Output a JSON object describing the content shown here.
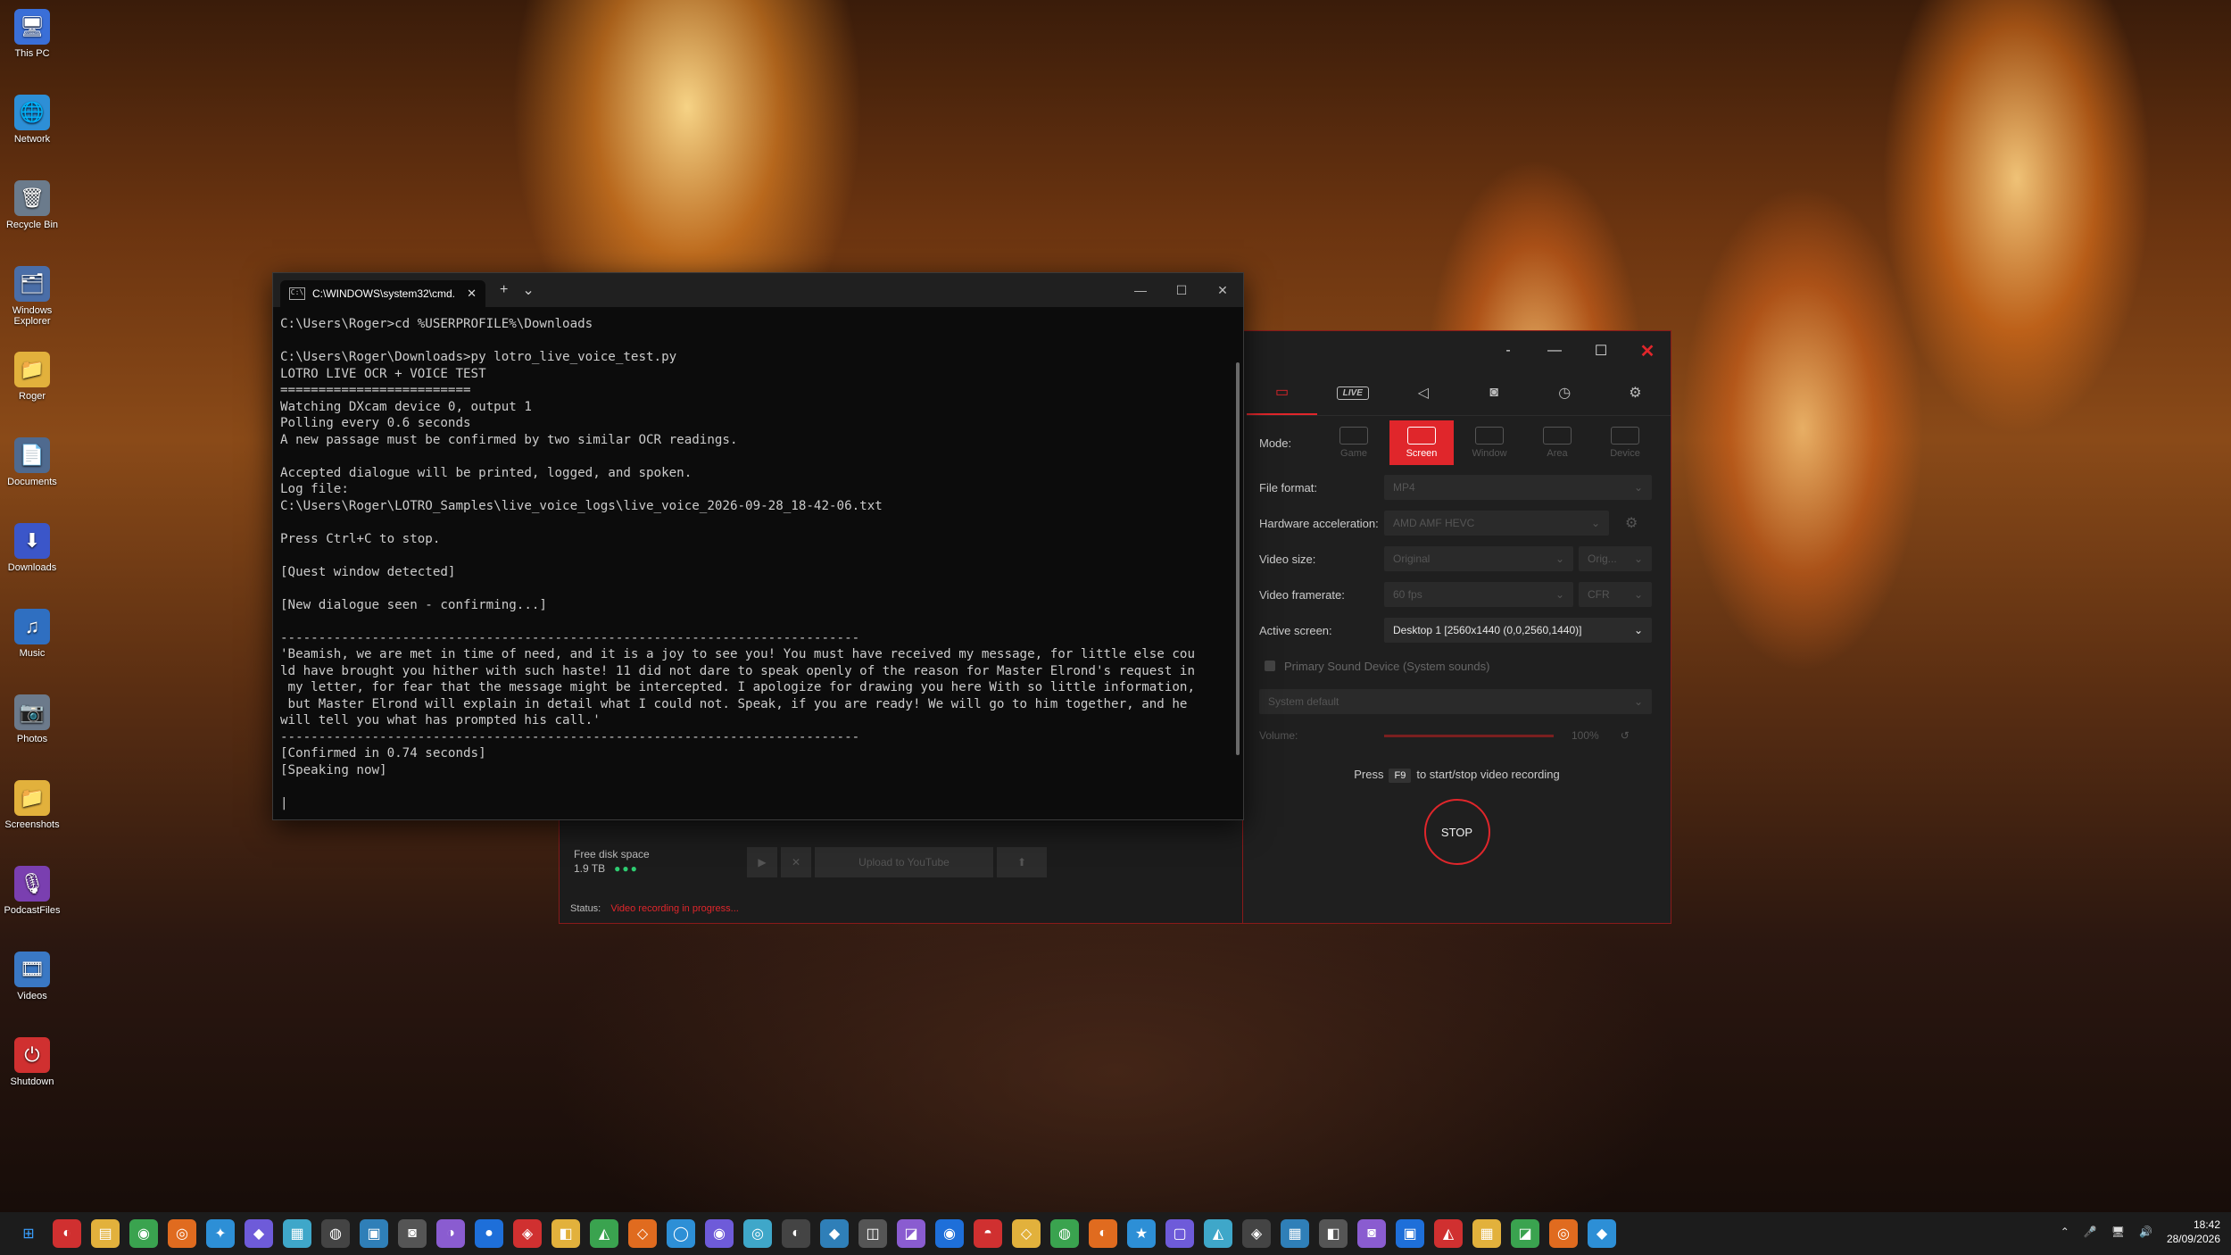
{
  "desktop": {
    "icons": [
      {
        "label": "This PC",
        "glyph": "🖥",
        "color": "#3a6fd8"
      },
      {
        "label": "Network",
        "glyph": "🌐",
        "color": "#2d8fd6"
      },
      {
        "label": "Recycle Bin",
        "glyph": "🗑",
        "color": "#6b7b8c"
      },
      {
        "label": "Windows Explorer",
        "glyph": "🗂",
        "color": "#4a6ea8"
      },
      {
        "label": "Roger",
        "glyph": "📁",
        "color": "#e2b13c"
      },
      {
        "label": "Documents",
        "glyph": "📄",
        "color": "#4f6a8f"
      },
      {
        "label": "Downloads",
        "glyph": "⬇",
        "color": "#3b56c9"
      },
      {
        "label": "Music",
        "glyph": "♫",
        "color": "#2f6fc1"
      },
      {
        "label": "Photos",
        "glyph": "📷",
        "color": "#6c7a8b"
      },
      {
        "label": "Screenshots",
        "glyph": "📁",
        "color": "#e2b13c"
      },
      {
        "label": "PodcastFiles",
        "glyph": "🎙",
        "color": "#7a3fb0"
      },
      {
        "label": "Videos",
        "glyph": "🎞",
        "color": "#3a78c4"
      },
      {
        "label": "Shutdown",
        "glyph": "⏻",
        "color": "#d03030"
      }
    ]
  },
  "terminal": {
    "tab_title": "C:\\WINDOWS\\system32\\cmd.",
    "tab_icon": "C:\\",
    "new_tab": "+",
    "dropdown": "⌄",
    "minimize": "—",
    "maximize": "☐",
    "close": "✕",
    "output": "C:\\Users\\Roger>cd %USERPROFILE%\\Downloads\n\nC:\\Users\\Roger\\Downloads>py lotro_live_voice_test.py\nLOTRO LIVE OCR + VOICE TEST\n=========================\nWatching DXcam device 0, output 1\nPolling every 0.6 seconds\nA new passage must be confirmed by two similar OCR readings.\n\nAccepted dialogue will be printed, logged, and spoken.\nLog file:\nC:\\Users\\Roger\\LOTRO_Samples\\live_voice_logs\\live_voice_2026-09-28_18-42-06.txt\n\nPress Ctrl+C to stop.\n\n[Quest window detected]\n\n[New dialogue seen - confirming...]\n\n----------------------------------------------------------------------------\n'Beamish, we are met in time of need, and it is a joy to see you! You must have received my message, for little else cou\nld have brought you hither with such haste! 11 did not dare to speak openly of the reason for Master Elrond's request in\n my letter, for fear that the message might be intercepted. I apologize for drawing you here With so little information,\n but Master Elrond will explain in detail what I could not. Speak, if you are ready! We will go to him together, and he\nwill tell you what has prompted his call.'\n----------------------------------------------------------------------------\n[Confirmed in 0.74 seconds]\n[Speaking now]\n\n|"
  },
  "recorder": {
    "titlebar": {
      "dash": "-",
      "minimize": "—",
      "maximize": "☐",
      "close": "✕"
    },
    "tabs": [
      {
        "name": "video",
        "glyph": "▭",
        "active": true
      },
      {
        "name": "live",
        "glyph": "LIVE",
        "active": false
      },
      {
        "name": "audio",
        "glyph": "◁",
        "active": false
      },
      {
        "name": "screenshot",
        "glyph": "◙",
        "active": false
      },
      {
        "name": "timer",
        "glyph": "◷",
        "active": false
      },
      {
        "name": "settings",
        "glyph": "⚙",
        "active": false
      }
    ],
    "mode_label": "Mode:",
    "modes": [
      {
        "label": "Game",
        "active": false
      },
      {
        "label": "Screen",
        "active": true
      },
      {
        "label": "Window",
        "active": false
      },
      {
        "label": "Area",
        "active": false
      },
      {
        "label": "Device",
        "active": false
      }
    ],
    "file_format_label": "File format:",
    "file_format_value": "MP4",
    "hw_accel_label": "Hardware acceleration:",
    "hw_accel_value": "AMD AMF HEVC",
    "video_size_label": "Video size:",
    "video_size_value": "Original",
    "video_size_value2": "Orig...",
    "framerate_label": "Video framerate:",
    "framerate_value": "60 fps",
    "framerate_value2": "CFR",
    "active_screen_label": "Active screen:",
    "active_screen_value": "Desktop 1 [2560x1440 (0,0,2560,1440)]",
    "sound_label": "Primary Sound Device (System sounds)",
    "sound_device_value": "System default",
    "volume_label": "Volume:",
    "volume_value": "100%",
    "hint_press": "Press",
    "hint_key": "F9",
    "hint_text": "to start/stop video recording",
    "stop_label": "STOP",
    "disk_label": "Free disk space",
    "disk_value": "1.9 TB",
    "upload_label": "Upload to YouTube",
    "status_label": "Status:",
    "status_value": "Video recording in progress..."
  },
  "taskbar": {
    "apps": [
      "⊞",
      "◐",
      "▤",
      "◉",
      "◎",
      "✦",
      "◆",
      "▦",
      "◍",
      "▣",
      "◙",
      "◑",
      "●",
      "◈",
      "◧",
      "◭",
      "◇",
      "◯",
      "◉",
      "◎",
      "◐",
      "◆",
      "◫",
      "◪",
      "◉",
      "◓",
      "◇",
      "◍",
      "◐",
      "★",
      "▢",
      "◭",
      "◈",
      "▦",
      "◧",
      "◙",
      "▣",
      "◭",
      "▦",
      "◪",
      "◎",
      "◆"
    ],
    "tray_icons": [
      "⌃",
      "🎤",
      "🖥",
      "🔊"
    ],
    "time": "18:42",
    "date": "28/09/2026"
  }
}
